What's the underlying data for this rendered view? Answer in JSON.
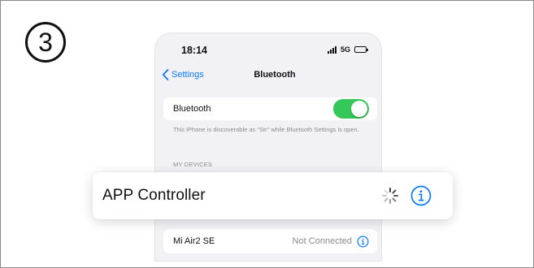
{
  "step": {
    "number": "3"
  },
  "phone": {
    "status_bar": {
      "time": "18:14",
      "network": "5G"
    },
    "nav": {
      "back_label": "Settings",
      "title": "Bluetooth"
    },
    "bluetooth": {
      "label": "Bluetooth",
      "enabled": true,
      "toggle_color": "#34c759",
      "note": "This iPhone is discoverable as \"Str\" while Bluetooth Settings is open."
    },
    "section_header": "MY DEVICES",
    "devices": [
      {
        "name": "Mi Air2 SE",
        "status": "Not Connected",
        "icon": "info-icon"
      }
    ]
  },
  "popup": {
    "label": "APP Controller",
    "icons": [
      "loading-spinner-icon",
      "info-icon"
    ]
  },
  "colors": {
    "accent": "#0a7aff",
    "background": "#f2f2f6",
    "secondary_text": "#8a8a8e"
  }
}
